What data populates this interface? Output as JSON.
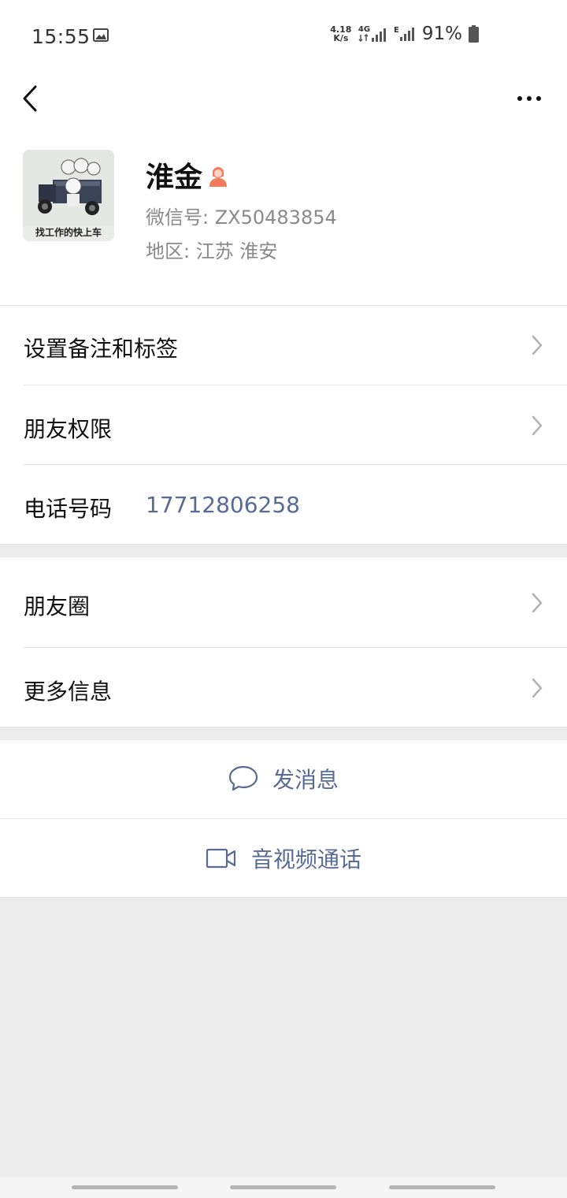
{
  "status_bar": {
    "time": "15:55",
    "net_speed_value": "4.18",
    "net_speed_unit": "K/s",
    "network_4g": "4G",
    "network_e": "E",
    "battery": "91%"
  },
  "profile": {
    "name": "淮金",
    "wechat_id": "微信号: ZX50483854",
    "region": "地区: 江苏  淮安",
    "avatar_caption": "找工作的快上车",
    "gender_color": "#f37b5b"
  },
  "rows": {
    "remark": "设置备注和标签",
    "permissions": "朋友权限",
    "phone_label": "电话号码",
    "phone_value": "17712806258",
    "moments": "朋友圈",
    "more_info": "更多信息"
  },
  "actions": {
    "message": "发消息",
    "video_call": "音视频通话"
  },
  "colors": {
    "link": "#576b95",
    "background": "#ededed"
  }
}
